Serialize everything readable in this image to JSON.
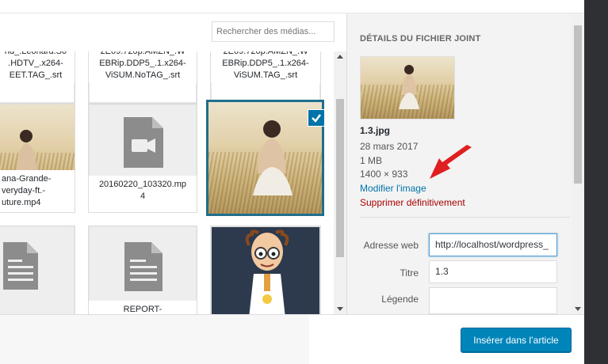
{
  "search": {
    "placeholder": "Rechercher des médias..."
  },
  "grid": {
    "row1": [
      {
        "label": "nd_.Leonard.S0\n.HDTV_.x264-\nEET.TAG_.srt"
      },
      {
        "label": "2E09.720p.AMZN_.W\nEBRip.DDP5_.1.x264-\nViSUM.NoTAG_.srt"
      },
      {
        "label": "2E09.720p.AMZN_.W\nEBRip.DDP5_.1.x264-\nViSUM.TAG_.srt"
      }
    ],
    "row2": [
      {
        "label": "ana-Grande-\nveryday-ft.-\nuture.mp4",
        "type": "video-photo"
      },
      {
        "label": "20160220_103320.mp\n4",
        "type": "video-icon"
      },
      {
        "label": "",
        "type": "photo",
        "selected": true
      }
    ],
    "row3": [
      {
        "label": "",
        "type": "document-icon"
      },
      {
        "label": "REPORT-",
        "type": "document-icon"
      },
      {
        "label": "",
        "type": "cartoon"
      }
    ]
  },
  "sidebar": {
    "title": "DÉTAILS DU FICHIER JOINT",
    "filename": "1.3.jpg",
    "date": "28 mars 2017",
    "size": "1 MB",
    "dimensions": "1400 × 933",
    "edit_link": "Modifier l'image",
    "delete_link": "Supprimer définitivement",
    "fields": {
      "url_label": "Adresse web",
      "url_value": "http://localhost/wordpress_",
      "title_label": "Titre",
      "title_value": "1.3",
      "caption_label": "Légende",
      "caption_value": ""
    }
  },
  "footer": {
    "insert_label": "Insérer dans l’article"
  },
  "colors": {
    "accent": "#0085ba",
    "selected_border": "#1e6e8c",
    "link": "#0073aa",
    "delete": "#aa0000",
    "annotation_arrow": "#e02020"
  }
}
